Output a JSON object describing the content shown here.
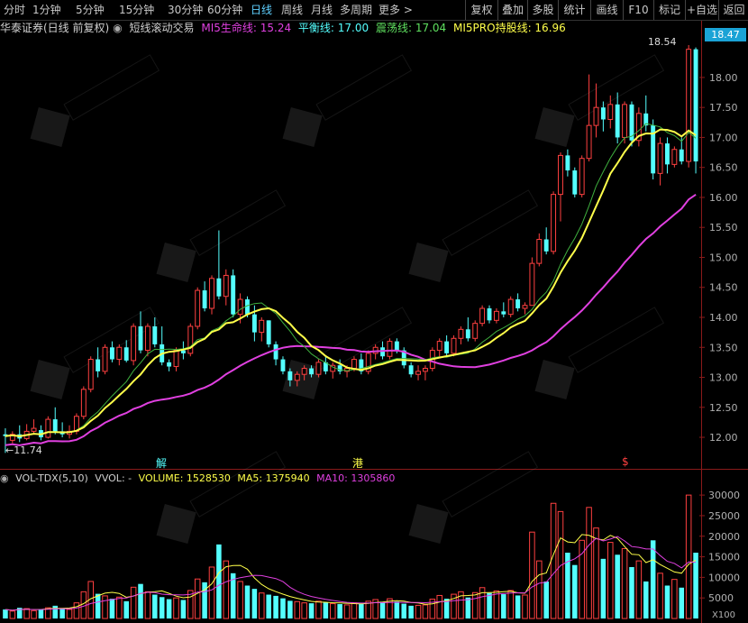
{
  "toolbar": {
    "period_tabs": [
      "分时",
      "1分钟",
      "5分钟",
      "15分钟",
      "30分钟",
      "60分钟",
      "日线",
      "周线",
      "月线",
      "多周期",
      "更多 >"
    ],
    "active_tab": "日线",
    "tools": [
      "复权",
      "叠加",
      "多股",
      "统计",
      "画线",
      "F10",
      "标记",
      "+自选",
      "返回"
    ]
  },
  "info": {
    "stock": "华泰证券(日线 前复权)",
    "indicator": "短线滚动交易",
    "mi5_life": "MI5生命线: 15.24",
    "balance": "平衡线: 17.00",
    "oscillation": "震荡线: 17.04",
    "mi5pro": "MI5PRO持股线: 16.96"
  },
  "price_axis": {
    "ticks": [
      "18.00",
      "17.50",
      "17.00",
      "16.50",
      "16.00",
      "15.50",
      "15.00",
      "14.50",
      "14.00",
      "13.50",
      "13.00",
      "12.50",
      "12.00"
    ],
    "current_price": "18.47"
  },
  "annotations": {
    "high": "18.54",
    "low": "11.74",
    "marker_jie": "解",
    "marker_gang": "港",
    "marker_s": "$"
  },
  "volume": {
    "title": "VOL-TDX(5,10)",
    "vvol": "VVOL: -",
    "volume": "VOLUME: 1528530",
    "ma5": "MA5: 1375940",
    "ma10": "MA10: 1305860",
    "ticks": [
      "30000",
      "25000",
      "20000",
      "15000",
      "10000",
      "5000"
    ],
    "unit": "X100"
  },
  "colors": {
    "up": "#ff4040",
    "down": "#54ffff",
    "yellow": "#ffff4a",
    "magenta": "#e040e0",
    "green": "#3fb03f",
    "active_tab": "#5fd0ff",
    "info_stock": "#d0d0d0",
    "mi5_life": "#e040e0",
    "balance": "#54ffff",
    "oscillation": "#5fe05f",
    "mi5pro": "#ffff4a"
  },
  "chart_data": {
    "type": "candlestick",
    "ylim": [
      11.7,
      18.6
    ],
    "candles": [
      [
        12.05,
        12.15,
        11.74,
        12.02
      ],
      [
        11.95,
        12.1,
        11.9,
        12.05
      ],
      [
        12.05,
        12.2,
        11.92,
        11.98
      ],
      [
        11.98,
        12.22,
        11.95,
        12.1
      ],
      [
        12.1,
        12.3,
        12.05,
        12.15
      ],
      [
        12.12,
        12.2,
        11.95,
        12.0
      ],
      [
        12.0,
        12.35,
        11.98,
        12.3
      ],
      [
        12.3,
        12.5,
        12.05,
        12.1
      ],
      [
        12.1,
        12.25,
        12.0,
        12.05
      ],
      [
        12.05,
        12.2,
        11.98,
        12.1
      ],
      [
        12.1,
        12.4,
        12.05,
        12.35
      ],
      [
        12.35,
        12.85,
        12.3,
        12.8
      ],
      [
        12.8,
        13.35,
        12.75,
        13.3
      ],
      [
        13.3,
        13.5,
        13.0,
        13.1
      ],
      [
        13.1,
        13.55,
        13.05,
        13.5
      ],
      [
        13.5,
        13.6,
        13.25,
        13.3
      ],
      [
        13.3,
        13.55,
        13.2,
        13.5
      ],
      [
        13.5,
        13.62,
        13.25,
        13.28
      ],
      [
        13.28,
        13.9,
        13.2,
        13.85
      ],
      [
        13.85,
        14.1,
        13.4,
        13.45
      ],
      [
        13.45,
        13.9,
        13.35,
        13.85
      ],
      [
        13.85,
        14.0,
        13.5,
        13.55
      ],
      [
        13.55,
        13.85,
        13.2,
        13.25
      ],
      [
        13.25,
        13.3,
        13.1,
        13.18
      ],
      [
        13.18,
        13.5,
        13.1,
        13.45
      ],
      [
        13.45,
        13.6,
        13.3,
        13.4
      ],
      [
        13.4,
        13.9,
        13.35,
        13.85
      ],
      [
        13.85,
        14.5,
        13.8,
        14.45
      ],
      [
        14.45,
        14.6,
        14.1,
        14.15
      ],
      [
        14.15,
        14.7,
        14.05,
        14.65
      ],
      [
        14.65,
        15.45,
        14.3,
        14.35
      ],
      [
        14.35,
        14.8,
        14.2,
        14.7
      ],
      [
        14.7,
        14.8,
        14.0,
        14.05
      ],
      [
        14.05,
        14.4,
        13.9,
        14.3
      ],
      [
        14.3,
        14.35,
        14.0,
        14.05
      ],
      [
        14.05,
        14.2,
        13.6,
        13.75
      ],
      [
        13.75,
        14.0,
        13.6,
        13.95
      ],
      [
        13.95,
        13.95,
        13.5,
        13.55
      ],
      [
        13.55,
        13.6,
        13.2,
        13.3
      ],
      [
        13.3,
        13.35,
        13.05,
        13.1
      ],
      [
        13.1,
        13.15,
        12.85,
        12.95
      ],
      [
        12.95,
        13.1,
        12.85,
        13.05
      ],
      [
        13.05,
        13.2,
        12.95,
        13.15
      ],
      [
        13.15,
        13.2,
        13.0,
        13.05
      ],
      [
        13.05,
        13.3,
        13.0,
        13.25
      ],
      [
        13.25,
        13.35,
        13.05,
        13.1
      ],
      [
        13.1,
        13.25,
        12.98,
        13.2
      ],
      [
        13.2,
        13.3,
        13.05,
        13.1
      ],
      [
        13.1,
        13.2,
        13.0,
        13.15
      ],
      [
        13.15,
        13.35,
        13.1,
        13.3
      ],
      [
        13.3,
        13.4,
        13.05,
        13.1
      ],
      [
        13.1,
        13.45,
        13.05,
        13.4
      ],
      [
        13.4,
        13.55,
        13.3,
        13.5
      ],
      [
        13.5,
        13.6,
        13.3,
        13.35
      ],
      [
        13.35,
        13.65,
        13.3,
        13.6
      ],
      [
        13.6,
        13.65,
        13.4,
        13.45
      ],
      [
        13.45,
        13.5,
        13.15,
        13.2
      ],
      [
        13.2,
        13.25,
        13.0,
        13.05
      ],
      [
        13.05,
        13.2,
        12.95,
        13.1
      ],
      [
        13.1,
        13.2,
        12.95,
        13.15
      ],
      [
        13.15,
        13.5,
        13.1,
        13.45
      ],
      [
        13.45,
        13.65,
        13.35,
        13.6
      ],
      [
        13.6,
        13.7,
        13.35,
        13.4
      ],
      [
        13.4,
        13.7,
        13.35,
        13.65
      ],
      [
        13.65,
        13.85,
        13.55,
        13.8
      ],
      [
        13.8,
        14.0,
        13.6,
        13.65
      ],
      [
        13.65,
        13.95,
        13.6,
        13.9
      ],
      [
        13.9,
        14.2,
        13.85,
        14.15
      ],
      [
        14.15,
        14.2,
        13.9,
        13.95
      ],
      [
        13.95,
        14.15,
        13.9,
        14.1
      ],
      [
        14.1,
        14.25,
        14.0,
        14.05
      ],
      [
        14.05,
        14.35,
        14.0,
        14.3
      ],
      [
        14.3,
        14.4,
        14.1,
        14.15
      ],
      [
        14.15,
        14.25,
        14.05,
        14.2
      ],
      [
        14.2,
        15.0,
        14.85,
        14.9
      ],
      [
        14.9,
        15.4,
        14.85,
        15.3
      ],
      [
        15.3,
        15.5,
        15.05,
        15.1
      ],
      [
        15.1,
        16.1,
        15.05,
        16.05
      ],
      [
        16.05,
        16.75,
        15.6,
        16.7
      ],
      [
        16.7,
        16.8,
        16.35,
        16.45
      ],
      [
        16.45,
        16.5,
        16.0,
        16.05
      ],
      [
        16.05,
        16.7,
        16.0,
        16.65
      ],
      [
        16.65,
        18.05,
        16.6,
        17.2
      ],
      [
        17.2,
        17.9,
        17.0,
        17.5
      ],
      [
        17.5,
        17.6,
        17.1,
        17.3
      ],
      [
        17.3,
        17.7,
        17.15,
        17.55
      ],
      [
        17.55,
        17.75,
        16.9,
        17.0
      ],
      [
        17.0,
        17.6,
        16.9,
        17.55
      ],
      [
        17.55,
        17.6,
        16.85,
        16.95
      ],
      [
        16.95,
        17.5,
        16.85,
        17.4
      ],
      [
        17.4,
        17.7,
        17.1,
        17.2
      ],
      [
        17.2,
        17.3,
        16.3,
        16.4
      ],
      [
        16.4,
        17.0,
        16.2,
        16.9
      ],
      [
        16.9,
        17.0,
        16.4,
        16.55
      ],
      [
        16.55,
        16.85,
        16.5,
        16.8
      ],
      [
        16.8,
        17.0,
        16.55,
        16.6
      ],
      [
        16.6,
        18.54,
        16.5,
        18.47
      ],
      [
        18.47,
        18.5,
        16.4,
        16.6
      ]
    ],
    "volumes": [
      2200,
      1800,
      2600,
      2400,
      1900,
      2300,
      2600,
      3100,
      2500,
      2200,
      3800,
      6500,
      9000,
      6000,
      5500,
      4800,
      5200,
      4200,
      7600,
      8400,
      6500,
      5800,
      5200,
      4700,
      5000,
      4500,
      6800,
      9600,
      8800,
      12500,
      18000,
      14000,
      11000,
      9000,
      8000,
      7200,
      6200,
      5800,
      5500,
      4900,
      4300,
      4100,
      3800,
      3700,
      4200,
      3900,
      3600,
      3500,
      3300,
      3800,
      3500,
      4200,
      4600,
      3900,
      4800,
      4100,
      3600,
      3100,
      3200,
      3300,
      4700,
      5600,
      4800,
      5900,
      6500,
      5100,
      6300,
      7500,
      6200,
      6700,
      5900,
      6800,
      5600,
      5700,
      21000,
      14000,
      9000,
      28000,
      26000,
      16000,
      13000,
      19000,
      27000,
      22000,
      14500,
      18500,
      15500,
      17000,
      12500,
      14000,
      9000,
      19000,
      11000,
      8000,
      9500,
      7500,
      30000,
      16000
    ]
  }
}
